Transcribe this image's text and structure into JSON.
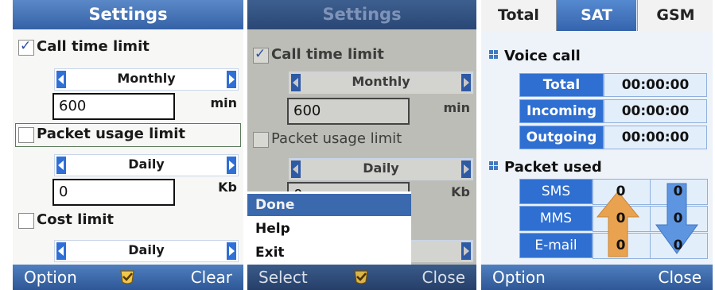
{
  "screen1": {
    "title": "Settings",
    "call_time_limit": {
      "label": "Call time limit",
      "checked": true,
      "period": "Monthly",
      "value": "600",
      "unit": "min"
    },
    "packet_usage_limit": {
      "label": "Packet usage limit",
      "checked": false,
      "period": "Daily",
      "value": "0",
      "unit": "Kb"
    },
    "cost_limit": {
      "label": "Cost limit",
      "checked": false,
      "period": "Daily"
    },
    "softkeys": {
      "left": "Option",
      "right": "Clear",
      "center_icon": "check-icon"
    }
  },
  "screen2": {
    "title": "Settings",
    "call_time_limit": {
      "label": "Call time limit",
      "checked": true,
      "period": "Monthly",
      "value": "600",
      "unit": "min"
    },
    "packet_usage_limit": {
      "label": "Packet usage limit",
      "checked": false,
      "period": "Daily",
      "value": "0",
      "unit": "Kb"
    },
    "menu": {
      "items": [
        "Done",
        "Help",
        "Exit"
      ],
      "selected": "Done"
    },
    "softkeys": {
      "left": "Select",
      "right": "Close",
      "center_icon": "check-icon"
    }
  },
  "screen3": {
    "tabs": [
      {
        "label": "Total"
      },
      {
        "label": "SAT",
        "selected": true
      },
      {
        "label": "GSM"
      }
    ],
    "voice_call": {
      "title": "Voice call",
      "rows": [
        {
          "label": "Total",
          "value": "00:00:00"
        },
        {
          "label": "Incoming",
          "value": "00:00:00"
        },
        {
          "label": "Outgoing",
          "value": "00:00:00"
        }
      ]
    },
    "packet_used": {
      "title": "Packet used",
      "rows": [
        {
          "label": "SMS",
          "sent": "0",
          "received": "0"
        },
        {
          "label": "MMS",
          "sent": "0",
          "received": "0"
        },
        {
          "label": "E-mail",
          "sent": "0",
          "received": "0"
        }
      ],
      "icons": [
        "arrow-up-icon",
        "arrow-down-icon"
      ]
    },
    "softkeys": {
      "left": "Option",
      "right": "Close"
    }
  },
  "colors": {
    "accent": "#3562a6",
    "highlight": "#3b69ad",
    "tab_selected": "#3564ad"
  }
}
